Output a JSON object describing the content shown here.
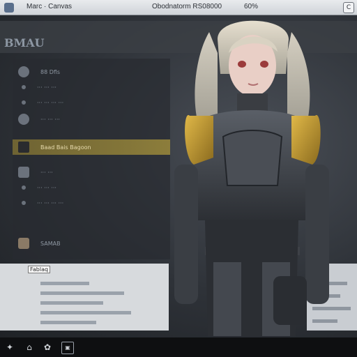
{
  "window": {
    "app_title": "Marc · Canvas",
    "document_title": "Obodnatorm RS08000",
    "zoom": "60%",
    "control_glyph": "C"
  },
  "header": {
    "brand": "BMAU"
  },
  "sidebar": {
    "items": [
      {
        "label": "88  Dfls",
        "icon": "circle-icon",
        "selected": false
      },
      {
        "label": "··· ··· ···",
        "icon": "dot-icon",
        "selected": false
      },
      {
        "label": "··· ··· ··· ···",
        "icon": "dot-icon",
        "selected": false
      },
      {
        "label": "··· ··· ···",
        "icon": "person-icon",
        "selected": false
      },
      {
        "label": "Baad  Bais Bagoon",
        "icon": "figure-icon",
        "selected": true
      },
      {
        "label": "··· ···",
        "icon": "box-icon",
        "selected": false
      },
      {
        "label": "··· ··· ···",
        "icon": "dot-icon",
        "selected": false
      },
      {
        "label": "···  ··· ··· ···",
        "icon": "dot-icon",
        "selected": false
      },
      {
        "label": "SAMAB",
        "icon": "jar-icon",
        "selected": false
      }
    ]
  },
  "bottom_panel": {
    "title": "Fablaq"
  },
  "taskbar": {
    "icons": [
      {
        "name": "person-icon",
        "glyph": "✦"
      },
      {
        "name": "home-icon",
        "glyph": "⌂"
      },
      {
        "name": "gear-icon",
        "glyph": "✿"
      },
      {
        "name": "disk-icon",
        "glyph": "▣"
      }
    ]
  },
  "colors": {
    "titlebar": "#dcdfe3",
    "accent_selected": "#8c7d3b",
    "panel": "#282b30"
  }
}
